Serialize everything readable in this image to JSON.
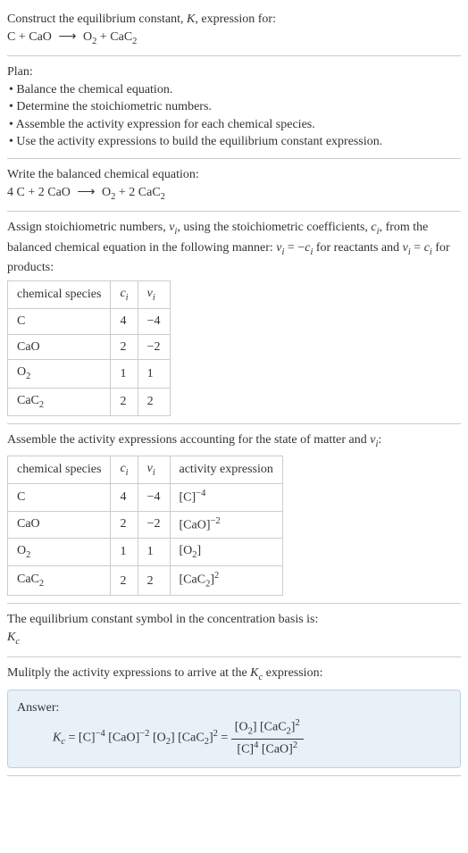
{
  "intro": {
    "line1": "Construct the equilibrium constant, ",
    "K": "K",
    "line1b": ", expression for:",
    "eq_lhs1": "C",
    "eq_plus": " + ",
    "eq_lhs2": "CaO",
    "eq_arrow": "⟶",
    "eq_rhs1": "O",
    "eq_rhs1_sub": "2",
    "eq_rhs2": "CaC",
    "eq_rhs2_sub": "2"
  },
  "plan": {
    "title": "Plan:",
    "b1": "• Balance the chemical equation.",
    "b2": "• Determine the stoichiometric numbers.",
    "b3": "• Assemble the activity expression for each chemical species.",
    "b4": "• Use the activity expressions to build the equilibrium constant expression."
  },
  "balanced": {
    "title": "Write the balanced chemical equation:",
    "c1": "4 C",
    "plus": " + ",
    "c2": "2 CaO",
    "arrow": "⟶",
    "c3": "O",
    "c3_sub": "2",
    "plus2": " + ",
    "c4": "2 CaC",
    "c4_sub": "2"
  },
  "stoich": {
    "text1": "Assign stoichiometric numbers, ",
    "nu_i": "ν",
    "sub_i": "i",
    "text2": ", using the stoichiometric coefficients, ",
    "c_i": "c",
    "text3": ", from the balanced chemical equation in the following manner: ",
    "rel1a": "ν",
    "rel1b": " = −",
    "rel1c": "c",
    "text4": " for reactants and ",
    "rel2a": "ν",
    "rel2b": " = ",
    "rel2c": "c",
    "text5": " for products:",
    "table": {
      "h1": "chemical species",
      "h2": "c",
      "h2_sub": "i",
      "h3": "ν",
      "h3_sub": "i",
      "rows": [
        {
          "s": "C",
          "s_sub": "",
          "c": "4",
          "n": "−4"
        },
        {
          "s": "CaO",
          "s_sub": "",
          "c": "2",
          "n": "−2"
        },
        {
          "s": "O",
          "s_sub": "2",
          "c": "1",
          "n": "1"
        },
        {
          "s": "CaC",
          "s_sub": "2",
          "c": "2",
          "n": "2"
        }
      ]
    }
  },
  "activity": {
    "text": "Assemble the activity expressions accounting for the state of matter and ",
    "nu": "ν",
    "sub_i": "i",
    "colon": ":",
    "table": {
      "h1": "chemical species",
      "h2": "c",
      "h2_sub": "i",
      "h3": "ν",
      "h3_sub": "i",
      "h4": "activity expression",
      "rows": [
        {
          "s": "C",
          "s_sub": "",
          "c": "4",
          "n": "−4",
          "a_base": "[C]",
          "a_exp": "−4"
        },
        {
          "s": "CaO",
          "s_sub": "",
          "c": "2",
          "n": "−2",
          "a_base": "[CaO]",
          "a_exp": "−2"
        },
        {
          "s": "O",
          "s_sub": "2",
          "c": "1",
          "n": "1",
          "a_base": "[O",
          "a_base_sub": "2",
          "a_base2": "]",
          "a_exp": ""
        },
        {
          "s": "CaC",
          "s_sub": "2",
          "c": "2",
          "n": "2",
          "a_base": "[CaC",
          "a_base_sub": "2",
          "a_base2": "]",
          "a_exp": "2"
        }
      ]
    }
  },
  "symbol": {
    "text": "The equilibrium constant symbol in the concentration basis is:",
    "K": "K",
    "sub": "c"
  },
  "final": {
    "text": "Mulitply the activity expressions to arrive at the ",
    "K": "K",
    "sub": "c",
    "text2": " expression:",
    "answer_label": "Answer:",
    "Kc": "K",
    "Kc_sub": "c",
    "eq": " = ",
    "t1": "[C]",
    "t1_exp": "−4",
    "sp": " ",
    "t2": "[CaO]",
    "t2_exp": "−2",
    "t3": "[O",
    "t3_sub": "2",
    "t3b": "]",
    "t4": "[CaC",
    "t4_sub": "2",
    "t4b": "]",
    "t4_exp": "2",
    "eq2": " = ",
    "num1": "[O",
    "num1_sub": "2",
    "num1b": "] ",
    "num2": "[CaC",
    "num2_sub": "2",
    "num2b": "]",
    "num2_exp": "2",
    "den1": "[C]",
    "den1_exp": "4",
    "den2": "[CaO]",
    "den2_exp": "2"
  }
}
